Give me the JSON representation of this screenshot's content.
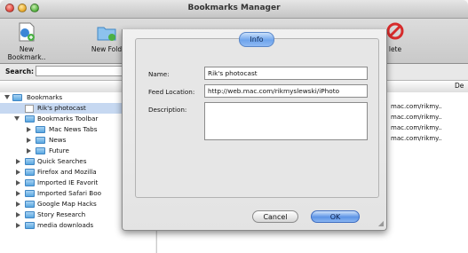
{
  "window": {
    "title": "Bookmarks Manager"
  },
  "toolbar": {
    "new_bookmark_label": "New Bookmark..",
    "new_folder_label": "New Fold",
    "delete_label": "lete"
  },
  "search": {
    "label": "Search:",
    "value": ""
  },
  "columns": {
    "right_header": "De"
  },
  "tree": {
    "items": [
      {
        "label": "Bookmarks",
        "icon": "folder-icon"
      },
      {
        "label": "Rik's photocast",
        "icon": "feed-icon"
      },
      {
        "label": "Bookmarks Toolbar",
        "icon": "folder-icon"
      },
      {
        "label": "Mac News Tabs",
        "icon": "folder-icon"
      },
      {
        "label": "News",
        "icon": "folder-icon"
      },
      {
        "label": "Future",
        "icon": "folder-icon"
      },
      {
        "label": "Quick Searches",
        "icon": "folder-icon"
      },
      {
        "label": "Firefox and Mozilla",
        "icon": "folder-icon"
      },
      {
        "label": "Imported IE Favorit",
        "icon": "folder-icon"
      },
      {
        "label": "Imported Safari Boo",
        "icon": "folder-icon"
      },
      {
        "label": "Google Map Hacks",
        "icon": "folder-icon"
      },
      {
        "label": "Story Research",
        "icon": "folder-icon"
      },
      {
        "label": "media downloads",
        "icon": "folder-icon"
      }
    ]
  },
  "right_pane": {
    "urls": [
      "mac.com/rikmy..",
      "mac.com/rikmy..",
      "mac.com/rikmy..",
      "mac.com/rikmy.."
    ]
  },
  "dialog": {
    "tab_label": "Info",
    "name_label": "Name:",
    "name_value": "Rik's photocast",
    "feed_location_label": "Feed Location:",
    "feed_location_value": "http://web.mac.com/rikmyslewski/iPhoto",
    "description_label": "Description:",
    "description_value": "",
    "cancel_label": "Cancel",
    "ok_label": "OK"
  },
  "colors": {
    "accent_blue": "#5d94e6",
    "selection": "#c6d8f1",
    "folder_blue": "#5aa7e0"
  }
}
